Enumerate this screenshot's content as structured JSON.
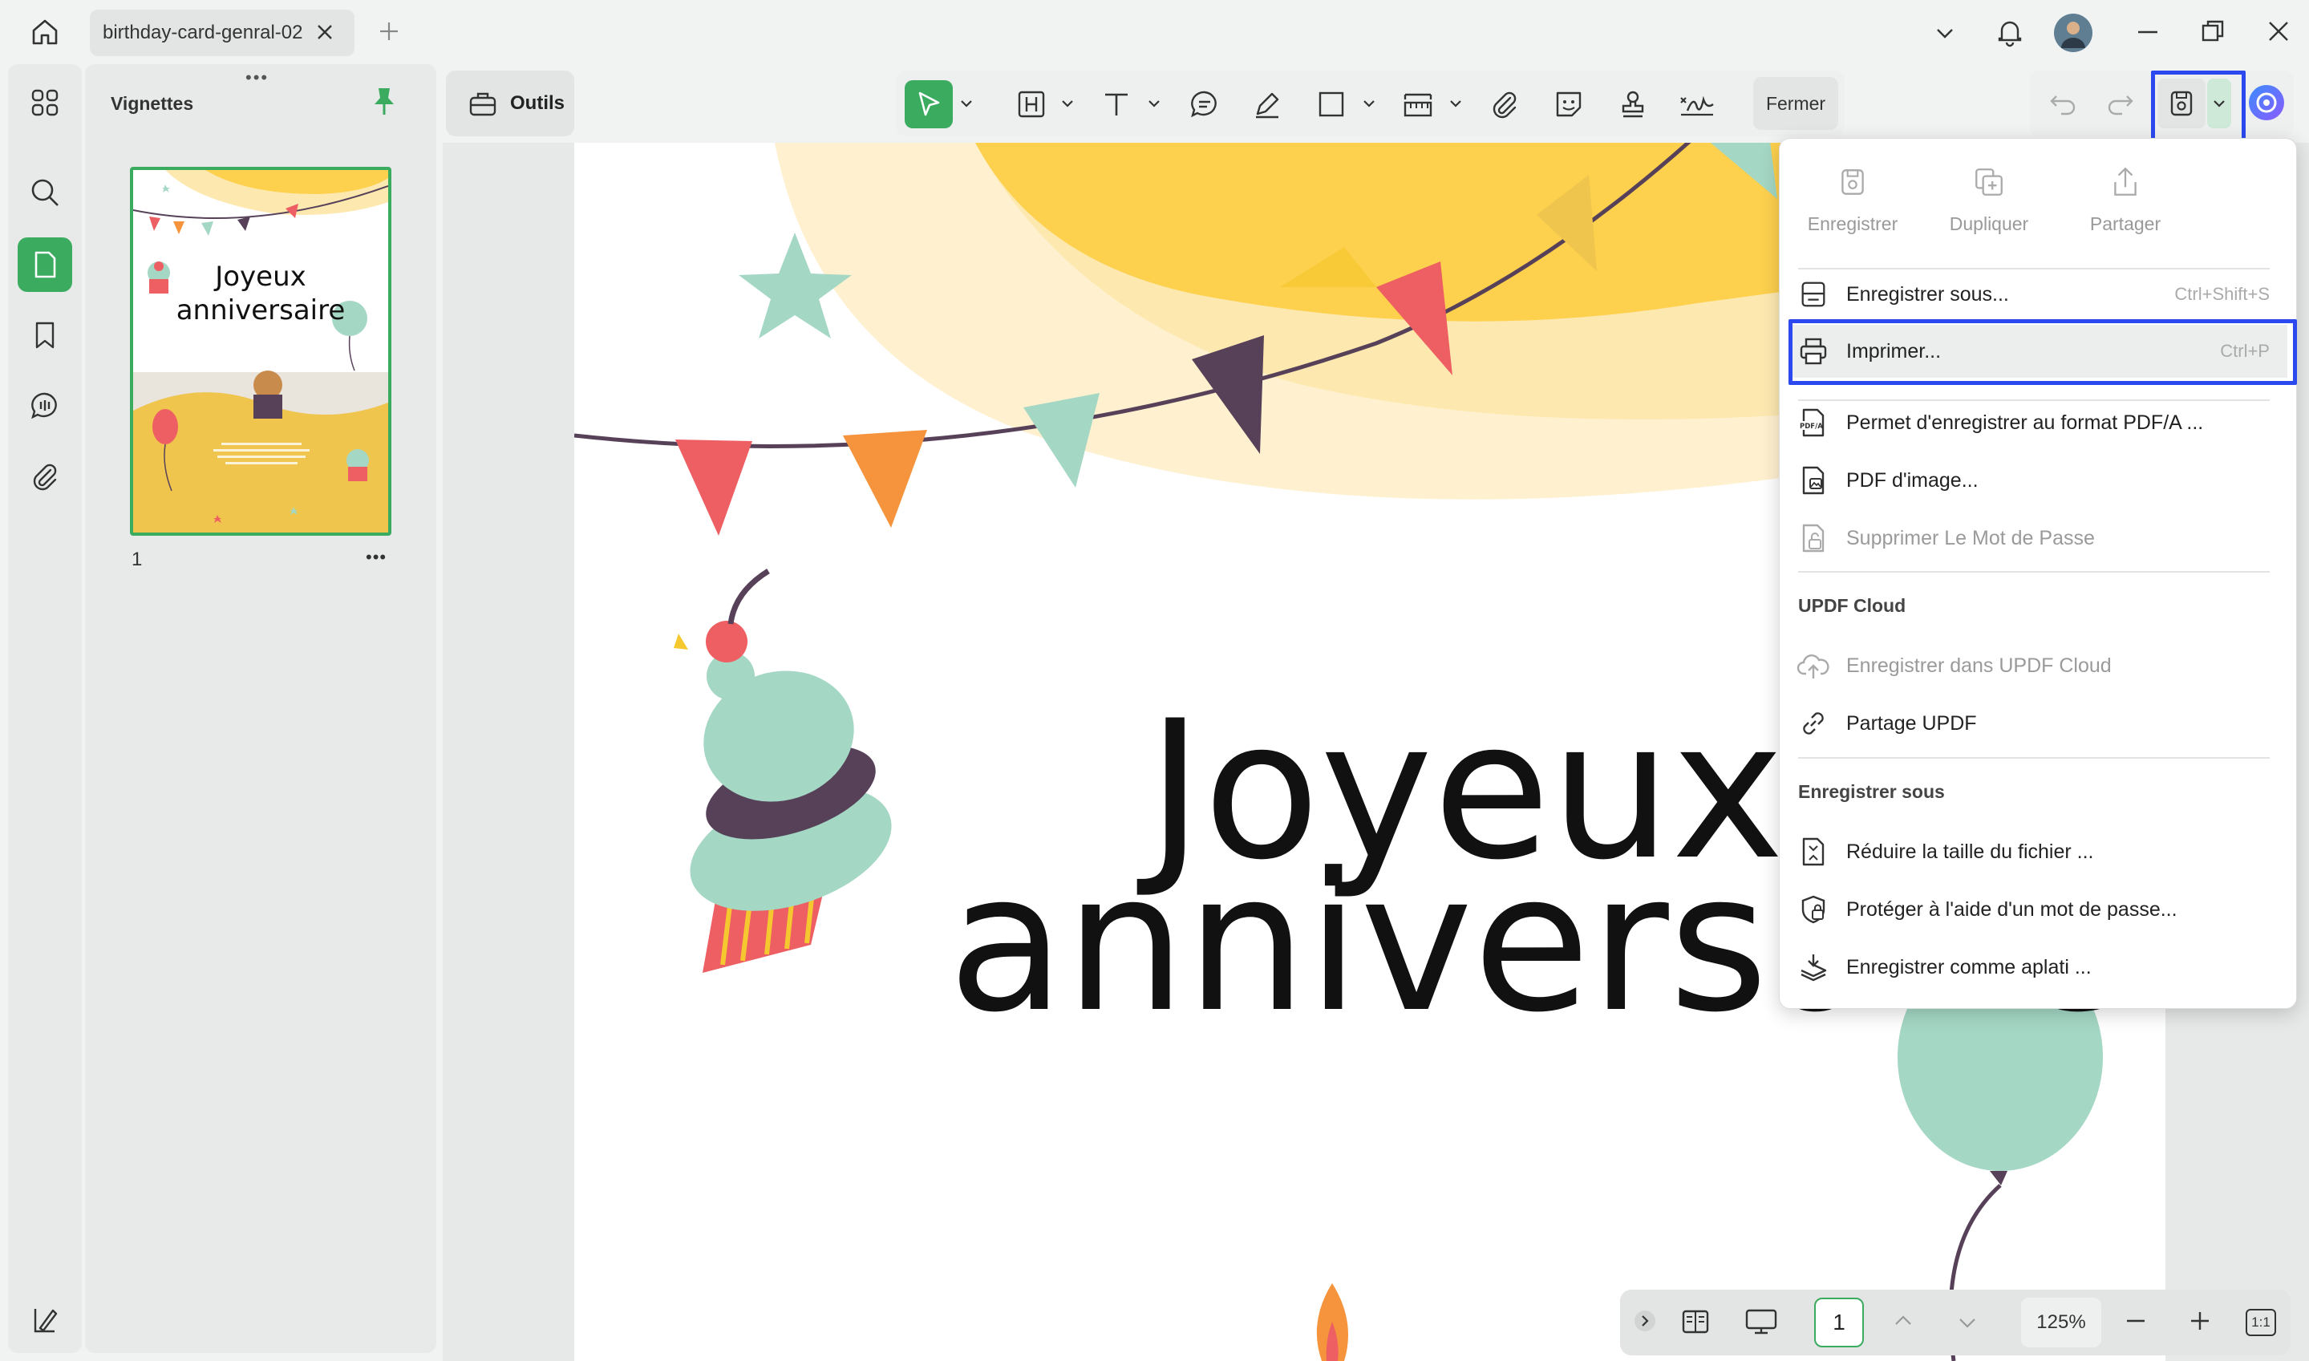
{
  "titlebar": {
    "tab_title": "birthday-card-genral-02"
  },
  "thumbnails": {
    "title": "Vignettes",
    "page_label": "1",
    "thumb_title_line1": "Joyeux",
    "thumb_title_line2": "anniversaire"
  },
  "toolbar": {
    "tools_label": "Outils",
    "close_label": "Fermer"
  },
  "document": {
    "line1": "Joyeux",
    "line2": "anniversaire"
  },
  "menu": {
    "top_actions": [
      "Enregistrer",
      "Dupliquer",
      "Partager"
    ],
    "save_as": {
      "label": "Enregistrer sous...",
      "shortcut": "Ctrl+Shift+S"
    },
    "print": {
      "label": "Imprimer...",
      "shortcut": "Ctrl+P"
    },
    "pdfa": "Permet d'enregistrer au format PDF/A ...",
    "pdf_image": "PDF d'image...",
    "remove_password": "Supprimer Le Mot de Passe",
    "cloud_section": "UPDF Cloud",
    "save_cloud": "Enregistrer dans UPDF Cloud",
    "share_updf": "Partage UPDF",
    "save_section": "Enregistrer sous",
    "reduce_size": "Réduire la taille du fichier ...",
    "protect": "Protéger à l'aide d'un mot de passe...",
    "flatten": "Enregistrer comme aplati ..."
  },
  "bottombar": {
    "page_number": "1",
    "zoom": "125%",
    "fit_label": "1:1"
  },
  "colors": {
    "accent": "#3aab5f",
    "focus_box": "#2c49ef",
    "sun_yellow": "#fdd04e",
    "teal": "#a4d7c4",
    "red": "#ee5f63",
    "orange": "#f5943c",
    "plum": "#574159"
  }
}
